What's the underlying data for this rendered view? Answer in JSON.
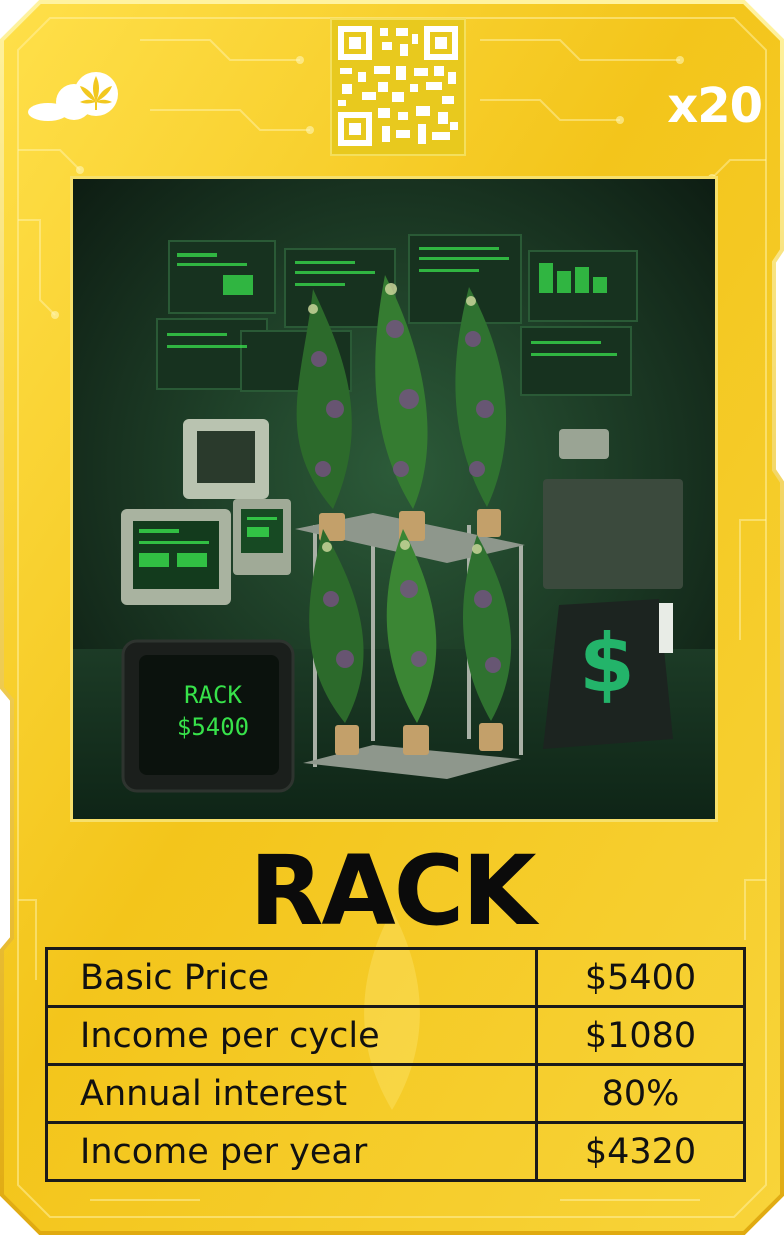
{
  "card": {
    "title": "RACK",
    "multiplier": "x20",
    "colors": {
      "frame": "#f2c81f",
      "frame_light": "#ffe566",
      "text": "#0b0b0b",
      "art_bg": "#12271a",
      "neon_green": "#37e24a"
    },
    "icons": [
      "cannabis-leaf-logo-icon",
      "qr-code-icon",
      "dollar-sign-icon"
    ]
  },
  "artwork": {
    "monitor_text_line1": "RACK",
    "monitor_text_line2": "$5400",
    "sign_text": "$"
  },
  "stats": [
    {
      "label": "Basic Price",
      "value": "$5400"
    },
    {
      "label": "Income per cycle",
      "value": "$1080"
    },
    {
      "label": "Annual interest",
      "value": "80%"
    },
    {
      "label": "Income per year",
      "value": "$4320"
    }
  ]
}
